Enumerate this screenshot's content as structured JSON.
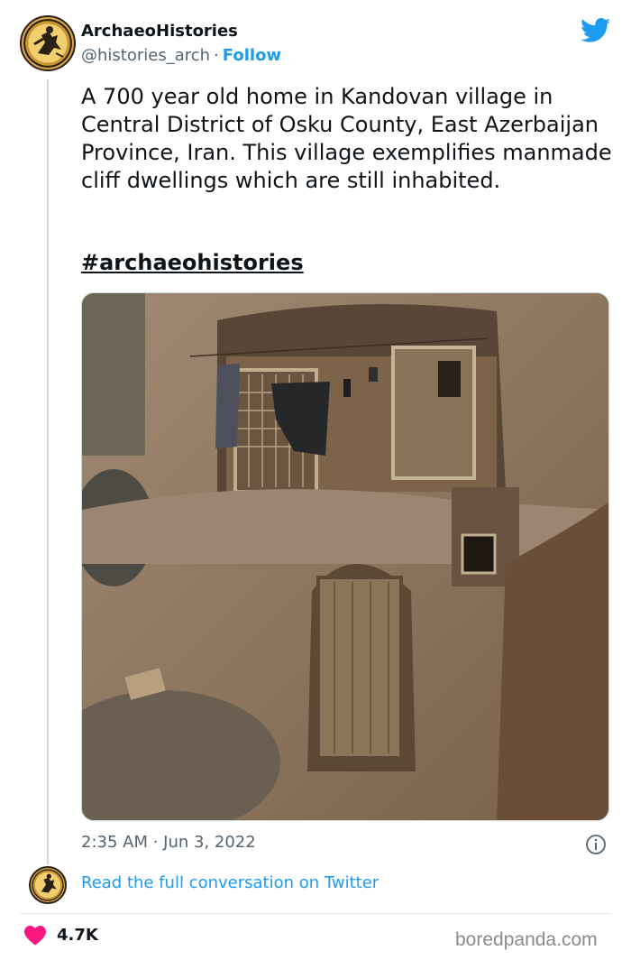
{
  "author": {
    "name": "ArchaeoHistories",
    "handle": "@histories_arch",
    "separator": "·",
    "follow_label": "Follow",
    "avatar_icon": "warrior-emblem-icon"
  },
  "tweet": {
    "text": "A 700 year old home in Kandovan village in Central District of Osku County, East Azerbaijan Province, Iran. This village exemplifies manmade cliff dwellings which are still inhabited.",
    "hashtag": "#archaeohistories",
    "timestamp": "2:35 AM · Jun 3, 2022"
  },
  "conversation": {
    "link_label": "Read the full conversation on Twitter"
  },
  "engagement": {
    "likes": "4.7K",
    "heart_color": "#f91880"
  },
  "footer": {
    "watermark": "boredpanda.com"
  },
  "colors": {
    "accent": "#1d9bf0",
    "text": "#0f1419",
    "muted": "#536471"
  }
}
